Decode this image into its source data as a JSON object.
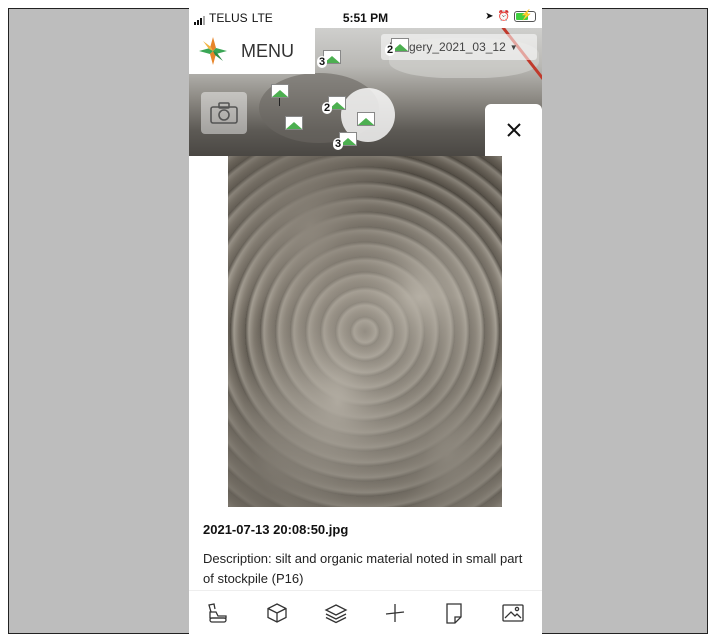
{
  "status_bar": {
    "carrier": "TELUS",
    "network": "LTE",
    "time": "5:51 PM"
  },
  "header": {
    "menu_label": "MENU",
    "imagery_layer": "Imagery_2021_03_12"
  },
  "map_markers": [
    {
      "count": "3"
    },
    {
      "count": "2"
    },
    {
      "count": "2"
    },
    {
      "count": "3"
    }
  ],
  "photo_panel": {
    "filename": "2021-07-13 20:08:50.jpg",
    "description": "Description: silt and organic material noted in small part of stockpile (P16)"
  },
  "toolbar": {
    "items": [
      "excavator-icon",
      "cube-icon",
      "layers-icon",
      "measure-icon",
      "note-icon",
      "image-icon"
    ]
  },
  "colors": {
    "accent_orange": "#e8852a",
    "accent_green": "#3aa655",
    "marker_green": "#4caf50"
  }
}
